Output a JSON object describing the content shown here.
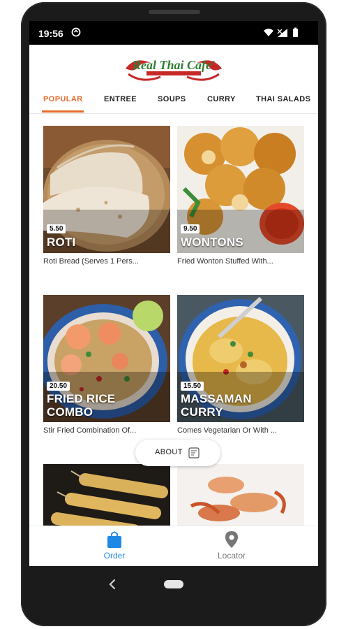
{
  "status": {
    "time": "19:56"
  },
  "brand": {
    "name": "Real Thai Cafe'",
    "accent": "#e86b2a",
    "order_blue": "#1e88e5"
  },
  "tabs": [
    {
      "label": "POPULAR",
      "active": true
    },
    {
      "label": "ENTREE"
    },
    {
      "label": "SOUPS"
    },
    {
      "label": "CURRY"
    },
    {
      "label": "THAI SALADS"
    }
  ],
  "items": [
    {
      "price": "5.50",
      "title": "ROTI",
      "desc": "Roti Bread (Serves 1 Pers..."
    },
    {
      "price": "9.50",
      "title": "WONTONS",
      "desc": "Fried Wonton Stuffed With..."
    },
    {
      "price": "20.50",
      "title_line1": "FRIED RICE",
      "title_line2": "COMBO",
      "desc": "Stir Fried Combination Of..."
    },
    {
      "price": "15.50",
      "title_line1": "MASSAMAN",
      "title_line2": "CURRY",
      "desc": "Comes Vegetarian Or With ..."
    }
  ],
  "about": {
    "label": "ABOUT"
  },
  "bottom_nav": [
    {
      "label": "Order",
      "icon": "shopping-bag-icon",
      "active": true
    },
    {
      "label": "Locator",
      "icon": "location-pin-icon"
    }
  ]
}
